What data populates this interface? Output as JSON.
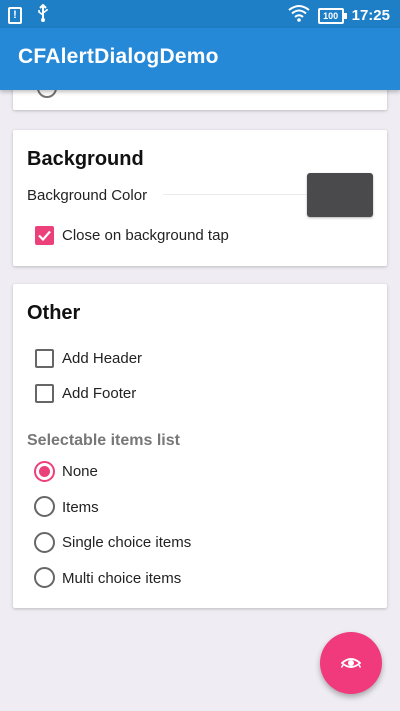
{
  "status_bar": {
    "notification_icon": "alert-notification-icon",
    "usb_icon": "usb-icon",
    "wifi_icon": "wifi-icon",
    "battery_level": "100",
    "time": "17:25"
  },
  "app_bar": {
    "title": "CFAlertDialogDemo",
    "color": "#2589d8"
  },
  "background_section": {
    "title": "Background",
    "color_label": "Background Color",
    "color_value": "#4a4a4c",
    "close_on_tap_label": "Close on background tap",
    "close_on_tap_checked": true
  },
  "other_section": {
    "title": "Other",
    "add_header_label": "Add Header",
    "add_header_checked": false,
    "add_footer_label": "Add Footer",
    "add_footer_checked": false,
    "list_subheader": "Selectable items list",
    "options": [
      {
        "label": "None",
        "selected": true
      },
      {
        "label": "Items",
        "selected": false
      },
      {
        "label": "Single choice items",
        "selected": false
      },
      {
        "label": "Multi choice items",
        "selected": false
      }
    ]
  },
  "fab": {
    "icon": "eye-icon",
    "color": "#f03a7c"
  },
  "accent_color": "#ec407a"
}
